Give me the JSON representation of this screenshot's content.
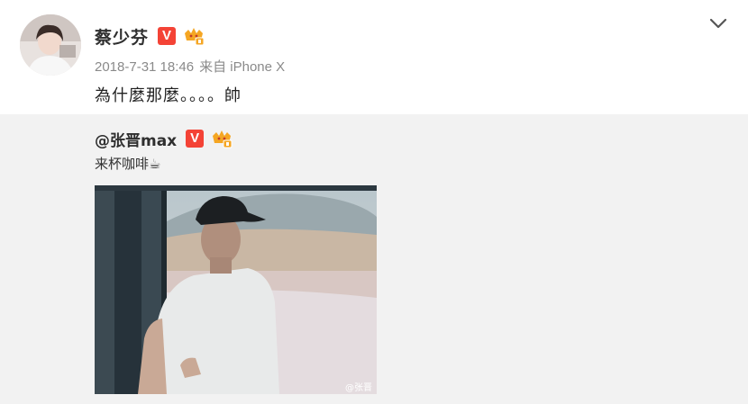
{
  "post": {
    "username": "蔡少芬",
    "verified_label": "V",
    "date": "2018-7-31 18:46",
    "source": "来自 iPhone X",
    "text": "為什麼那麼。。。。帥"
  },
  "repost": {
    "username": "@张晋max",
    "verified_label": "V",
    "text": "来杯咖啡☕",
    "watermark": "@张晋"
  },
  "colors": {
    "verified": "#f44336",
    "crown": "#f5a623",
    "meta_text": "#8a8a8a",
    "repost_bg": "#f2f2f2"
  },
  "icons": {
    "menu": "chevron-down-icon",
    "verified": "verified-v-icon",
    "member": "crown-member-icon"
  }
}
